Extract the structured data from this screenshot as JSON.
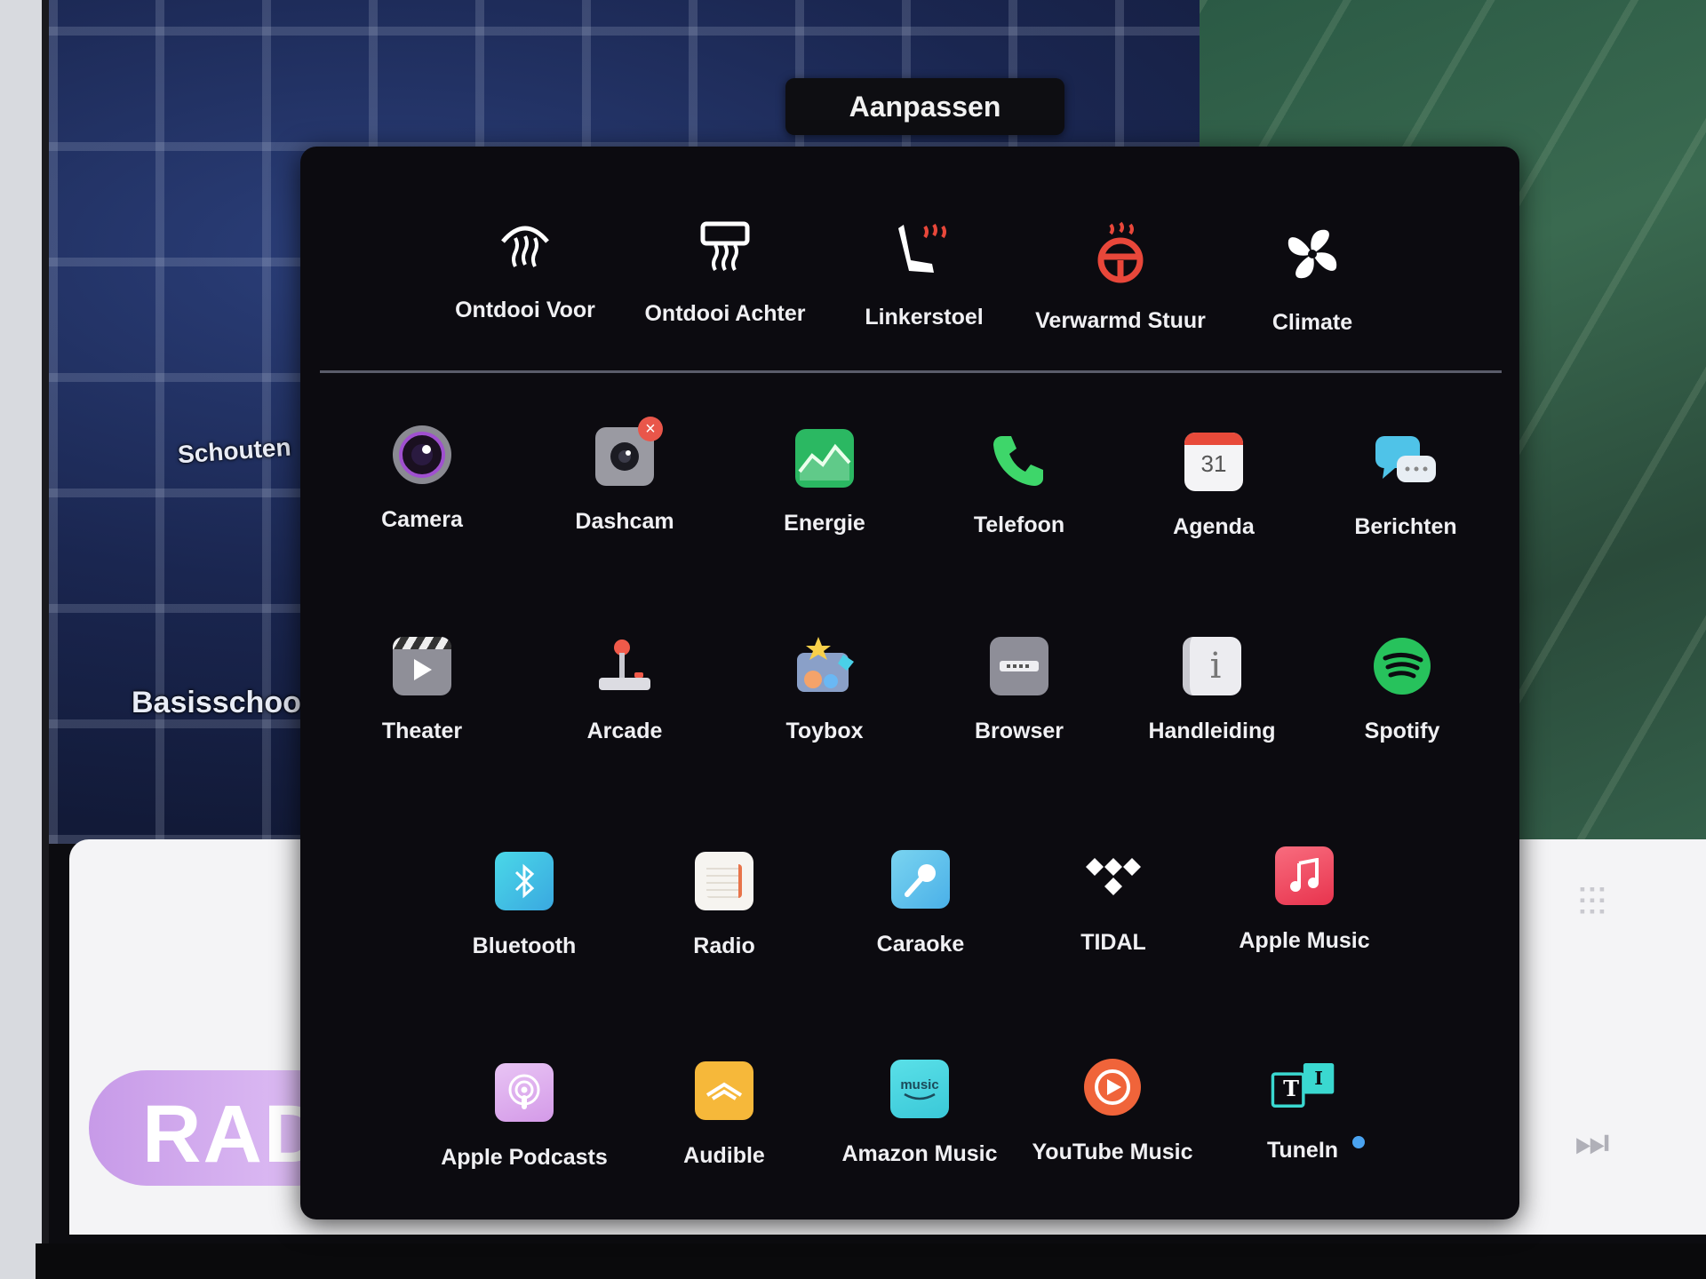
{
  "tooltip": {
    "label": "Aanpassen"
  },
  "map": {
    "labels": [
      "Schouten",
      "Basisschoo"
    ]
  },
  "media": {
    "source_label": "RAD"
  },
  "shortcuts": [
    {
      "label": "Ontdooi Voor",
      "icon": "front-defrost-icon",
      "color": "#ffffff"
    },
    {
      "label": "Ontdooi Achter",
      "icon": "rear-defrost-icon",
      "color": "#ffffff"
    },
    {
      "label": "Linkerstoel",
      "icon": "seat-heater-icon",
      "color": "#ffffff"
    },
    {
      "label": "Verwarmd Stuur",
      "icon": "heated-steering-icon",
      "color": "#e8473a"
    },
    {
      "label": "Climate",
      "icon": "fan-icon",
      "color": "#ffffff"
    }
  ],
  "apps": [
    {
      "label": "Camera",
      "icon": "camera-icon"
    },
    {
      "label": "Dashcam",
      "icon": "dashcam-icon"
    },
    {
      "label": "Energie",
      "icon": "energy-icon"
    },
    {
      "label": "Telefoon",
      "icon": "phone-icon"
    },
    {
      "label": "Agenda",
      "icon": "calendar-icon",
      "badge": "31"
    },
    {
      "label": "Berichten",
      "icon": "messages-icon"
    },
    {
      "label": "Theater",
      "icon": "theater-icon"
    },
    {
      "label": "Arcade",
      "icon": "arcade-icon"
    },
    {
      "label": "Toybox",
      "icon": "toybox-icon"
    },
    {
      "label": "Browser",
      "icon": "browser-icon"
    },
    {
      "label": "Handleiding",
      "icon": "manual-icon"
    },
    {
      "label": "Spotify",
      "icon": "spotify-icon"
    },
    {
      "label": "Bluetooth",
      "icon": "bluetooth-icon"
    },
    {
      "label": "Radio",
      "icon": "radio-icon"
    },
    {
      "label": "Caraoke",
      "icon": "caraoke-icon"
    },
    {
      "label": "TIDAL",
      "icon": "tidal-icon"
    },
    {
      "label": "Apple Music",
      "icon": "apple-music-icon"
    },
    {
      "label": "Apple Podcasts",
      "icon": "apple-podcasts-icon"
    },
    {
      "label": "Audible",
      "icon": "audible-icon"
    },
    {
      "label": "Amazon Music",
      "icon": "amazon-music-icon",
      "badge": "music"
    },
    {
      "label": "YouTube Music",
      "icon": "youtube-music-icon"
    },
    {
      "label": "TuneIn",
      "icon": "tunein-icon",
      "badge": "T"
    }
  ]
}
